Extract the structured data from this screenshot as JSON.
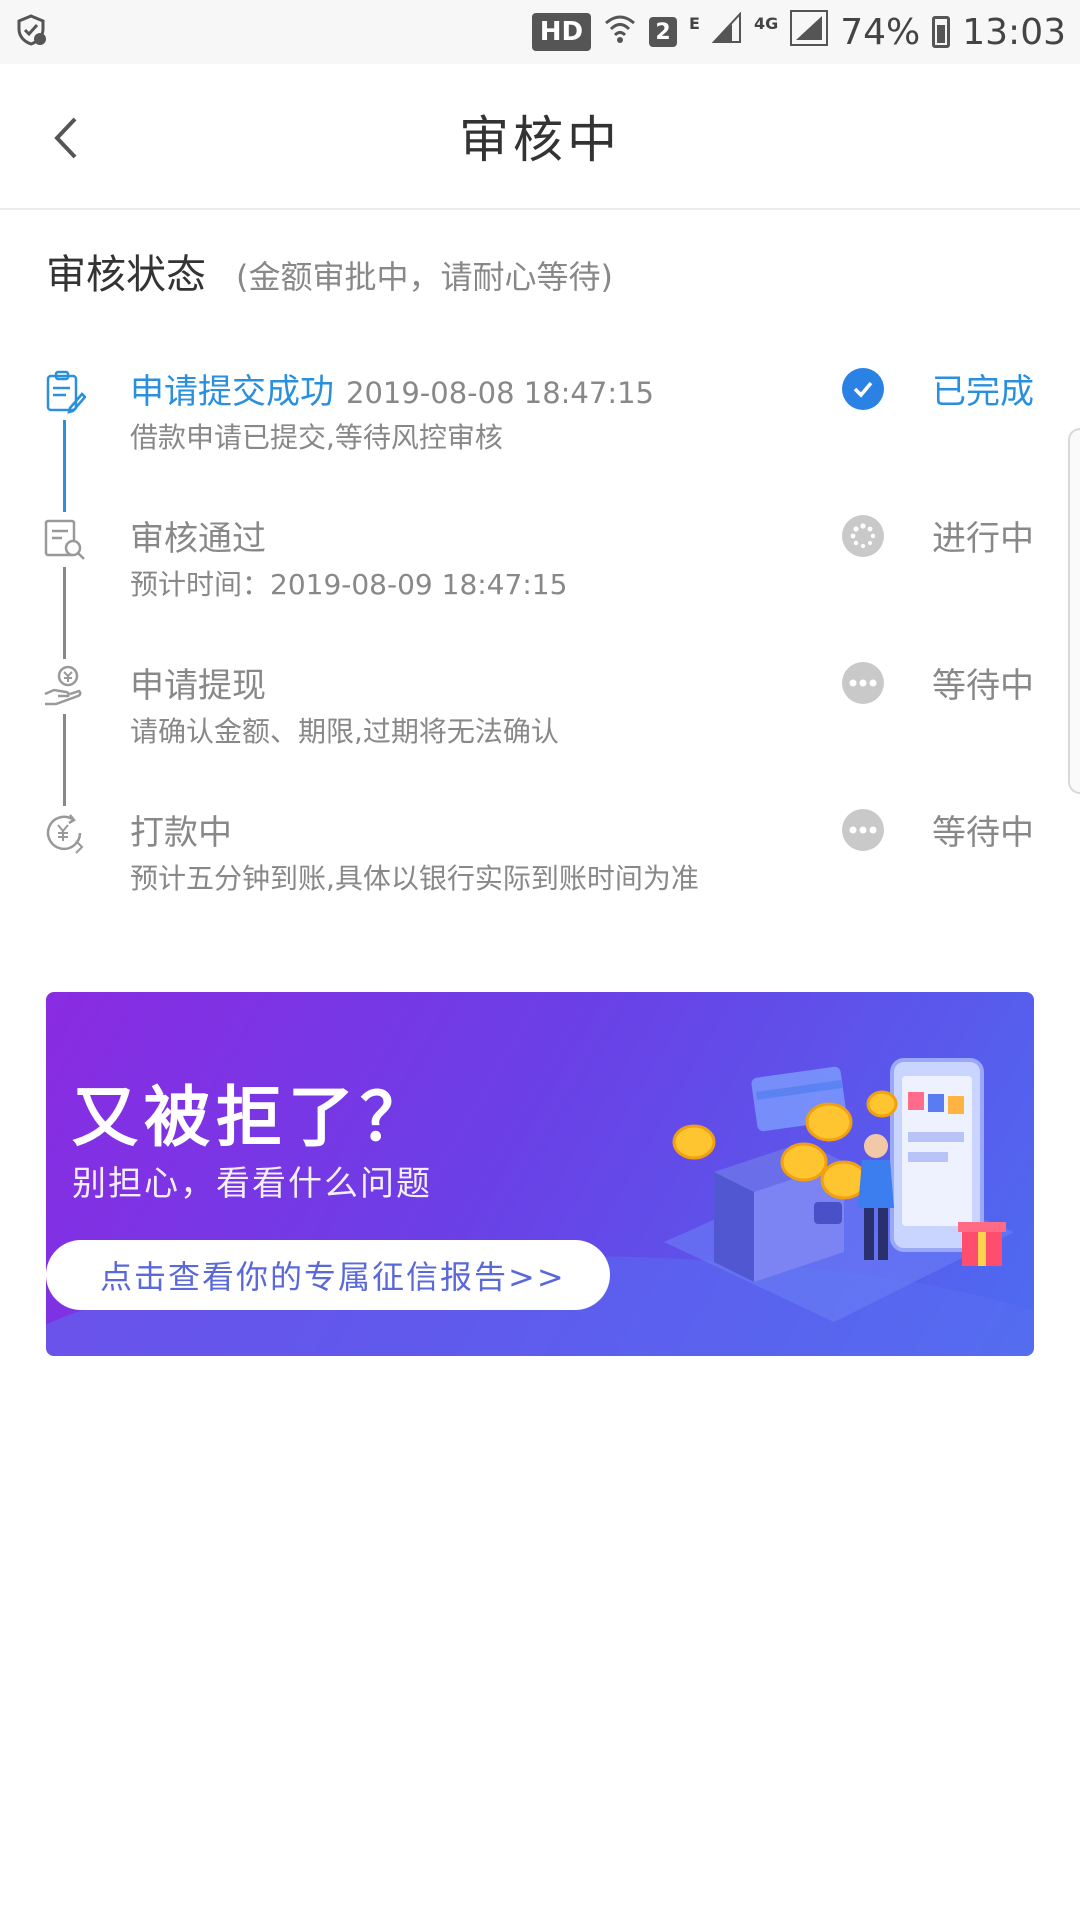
{
  "status_bar": {
    "hd": "HD",
    "sim": "2",
    "network_e": "E",
    "network_4g": "4G",
    "battery": "74%",
    "time": "13:03"
  },
  "header": {
    "title": "审核中"
  },
  "section": {
    "title": "审核状态",
    "note": "(金额审批中，请耐心等待)"
  },
  "steps": [
    {
      "title": "申请提交成功",
      "time": "2019-08-08 18:47:15",
      "desc": "借款申请已提交,等待风控审核",
      "status": "已完成",
      "icon": "clipboard-edit-icon",
      "state": "done"
    },
    {
      "title": "审核通过",
      "time": "",
      "desc": "预计时间：2019-08-09 18:47:15",
      "status": "进行中",
      "icon": "document-search-icon",
      "state": "progress"
    },
    {
      "title": "申请提现",
      "time": "",
      "desc": "请确认金额、期限,过期将无法确认",
      "status": "等待中",
      "icon": "hand-yuan-icon",
      "state": "waiting"
    },
    {
      "title": "打款中",
      "time": "",
      "desc": "预计五分钟到账,具体以银行实际到账时间为准",
      "status": "等待中",
      "icon": "yuan-clock-icon",
      "state": "waiting"
    }
  ],
  "banner": {
    "title": "又被拒了？",
    "subtitle": "别担心，看看什么问题",
    "cta": "点击查看你的专属征信报告>>"
  },
  "colors": {
    "accent": "#2a8fdc",
    "gray_text": "#888888",
    "banner_start": "#8a2be2",
    "banner_end": "#4d6cf0"
  }
}
